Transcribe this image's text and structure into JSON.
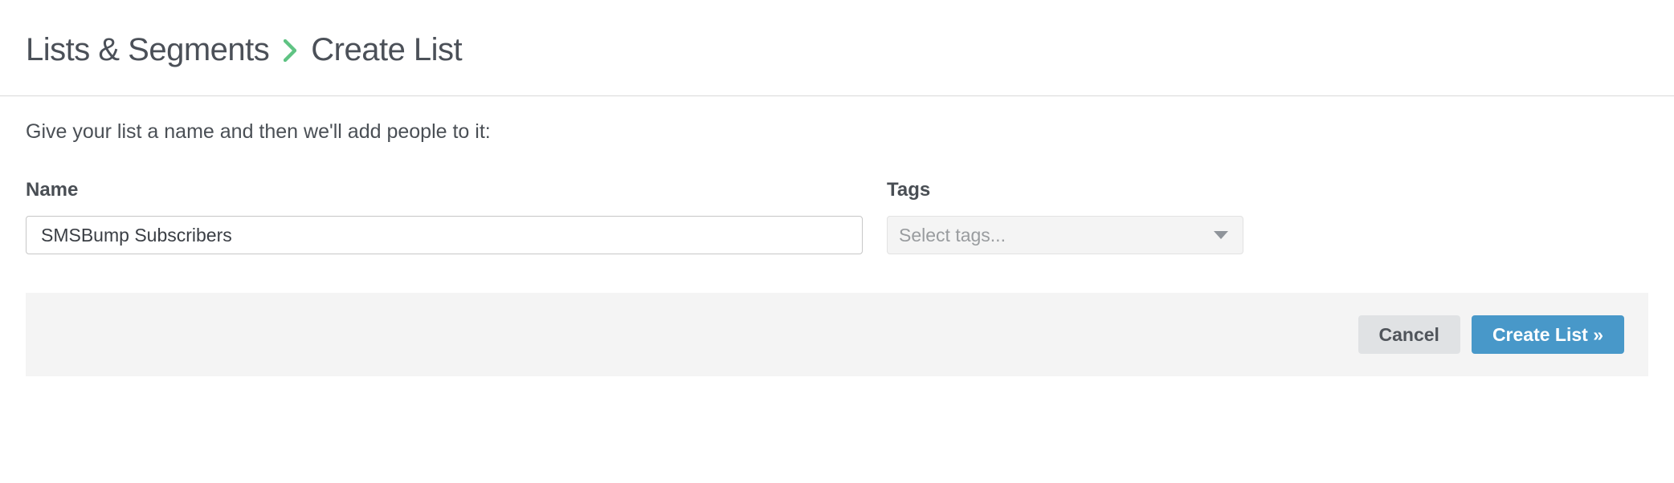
{
  "breadcrumb": {
    "parent": "Lists & Segments",
    "current": "Create List"
  },
  "instruction_text": "Give your list a name and then we'll add people to it:",
  "form": {
    "name_label": "Name",
    "name_value": "SMSBump Subscribers",
    "tags_label": "Tags",
    "tags_placeholder": "Select tags..."
  },
  "actions": {
    "cancel_label": "Cancel",
    "create_label": "Create List »"
  }
}
